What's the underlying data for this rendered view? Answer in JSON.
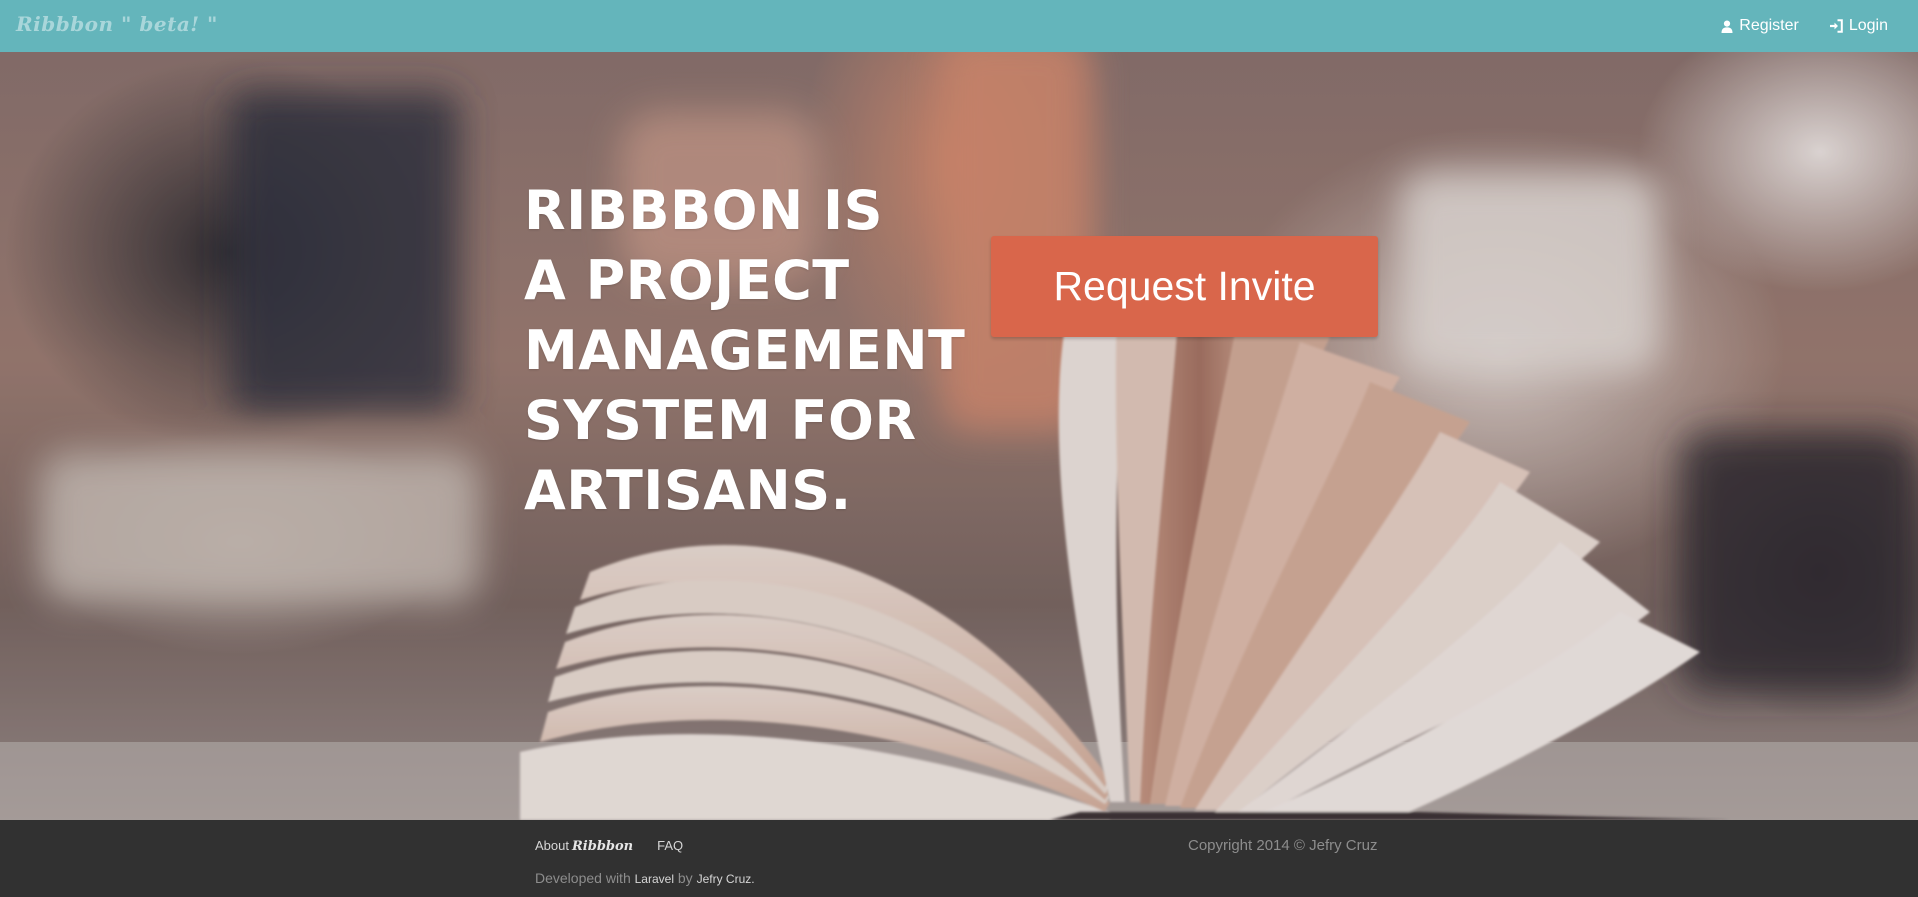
{
  "navbar": {
    "brand": "Ribbbon \" beta! \"",
    "links": [
      {
        "label": "Register",
        "icon": "user-icon"
      },
      {
        "label": "Login",
        "icon": "login-icon"
      }
    ],
    "background_color": "#64b5bb"
  },
  "hero": {
    "title_lines": [
      "RIBBBON IS",
      "A PROJECT",
      "MANAGEMENT",
      "SYSTEM FOR",
      "ARTISANS."
    ],
    "cta_label": "Request Invite",
    "cta_color": "#d9664b"
  },
  "footer": {
    "about_label": "About",
    "about_brand": "Ribbbon",
    "faq_label": "FAQ",
    "developed_prefix": "Developed with",
    "developed_framework": "Laravel",
    "developed_by": "by",
    "developed_author": "Jefry Cruz.",
    "copyright": "Copyright 2014 © Jefry Cruz",
    "background_color": "#313131"
  }
}
